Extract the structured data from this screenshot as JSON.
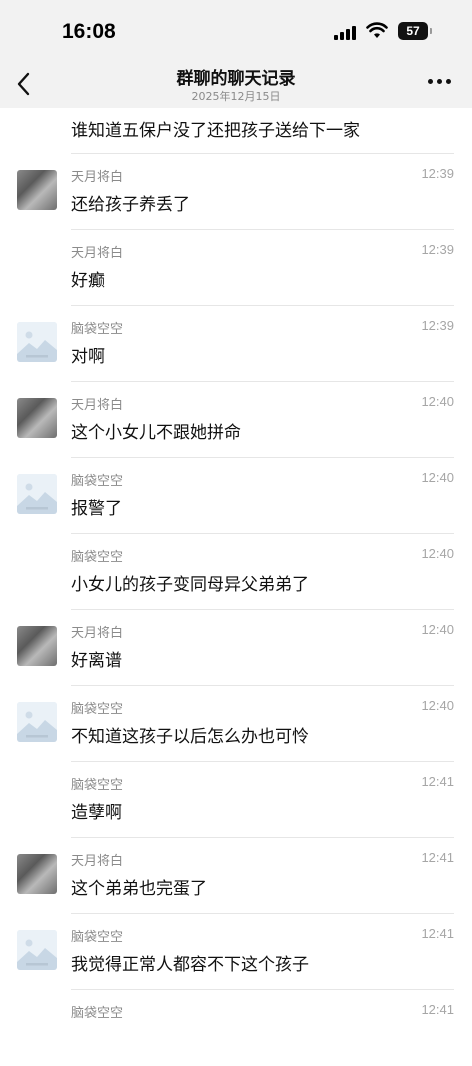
{
  "status_bar": {
    "time": "16:08",
    "battery": "57"
  },
  "header": {
    "title": "群聊的聊天记录",
    "subtitle": "2025年12月15日"
  },
  "partial_message": {
    "text": "谁知道五保户没了还把孩子送给下一家"
  },
  "messages": [
    {
      "name": "天月将白",
      "time": "12:39",
      "text": "还给孩子养丢了",
      "avatar": "cat"
    },
    {
      "name": "天月将白",
      "time": "12:39",
      "text": "好癫",
      "avatar": "none"
    },
    {
      "name": "脑袋空空",
      "time": "12:39",
      "text": "对啊",
      "avatar": "image"
    },
    {
      "name": "天月将白",
      "time": "12:40",
      "text": "这个小女儿不跟她拼命",
      "avatar": "cat"
    },
    {
      "name": "脑袋空空",
      "time": "12:40",
      "text": "报警了",
      "avatar": "image"
    },
    {
      "name": "脑袋空空",
      "time": "12:40",
      "text": "小女儿的孩子变同母异父弟弟了",
      "avatar": "none"
    },
    {
      "name": "天月将白",
      "time": "12:40",
      "text": "好离谱",
      "avatar": "cat"
    },
    {
      "name": "脑袋空空",
      "time": "12:40",
      "text": "不知道这孩子以后怎么办也可怜",
      "avatar": "image"
    },
    {
      "name": "脑袋空空",
      "time": "12:41",
      "text": "造孽啊",
      "avatar": "none"
    },
    {
      "name": "天月将白",
      "time": "12:41",
      "text": "这个弟弟也完蛋了",
      "avatar": "cat"
    },
    {
      "name": "脑袋空空",
      "time": "12:41",
      "text": "我觉得正常人都容不下这个孩子",
      "avatar": "image"
    },
    {
      "name": "脑袋空空",
      "time": "12:41",
      "text": "",
      "avatar": "none"
    }
  ],
  "icons": {
    "back": "chevron-left-icon",
    "more": "more-dots-icon",
    "wifi": "wifi-icon",
    "signal": "signal-icon",
    "battery": "battery-icon"
  },
  "colors": {
    "background": "#ffffff",
    "header_bg": "#f2f2f2",
    "name": "#8b8b8b",
    "text": "#111111"
  }
}
